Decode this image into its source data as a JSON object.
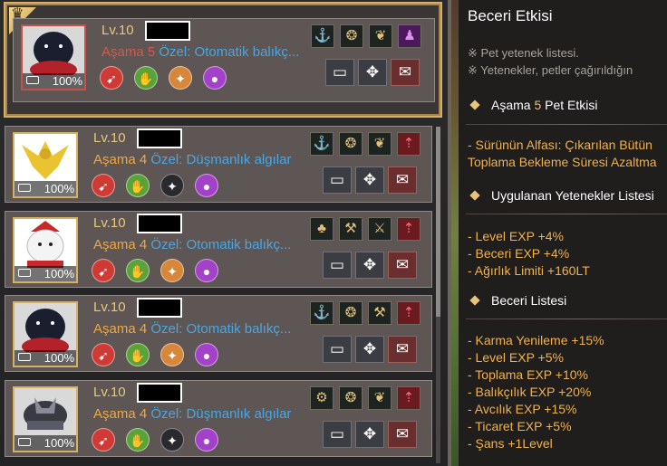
{
  "pets": [
    {
      "level": "Lv.10",
      "stage_label": "Aşama",
      "stage_num": "5",
      "special": "Özel: Otomatik balıkç...",
      "hunger": "100%"
    },
    {
      "level": "Lv.10",
      "stage_label": "Aşama",
      "stage_num": "4",
      "special": "Özel: Düşmanlık algılar",
      "hunger": "100%"
    },
    {
      "level": "Lv.10",
      "stage_label": "Aşama",
      "stage_num": "4",
      "special": "Özel: Otomatik balıkç...",
      "hunger": "100%"
    },
    {
      "level": "Lv.10",
      "stage_label": "Aşama",
      "stage_num": "4",
      "special": "Özel: Otomatik balıkç...",
      "hunger": "100%"
    },
    {
      "level": "Lv.10",
      "stage_label": "Aşama",
      "stage_num": "4",
      "special": "Özel: Düşmanlık algılar",
      "hunger": "100%"
    }
  ],
  "panel": {
    "title": "Beceri Etkisi",
    "note1": "※ Pet yetenek listesi.",
    "note2": "※ Yetenekler, petler çağırıldığın",
    "section_stage_pre": "Aşama",
    "section_stage_num": "5",
    "section_stage_post": "Pet Etkisi",
    "alpha1": "- Sürünün Alfası: Çıkarılan Bütün",
    "alpha2": "Toplama Bekleme Süresi Azaltma",
    "section_applied": "Uygulanan Yetenekler Listesi",
    "applied": [
      {
        "label": "- Level EXP",
        "value": "+4%"
      },
      {
        "label": "- Beceri EXP",
        "value": "+4%"
      },
      {
        "label": "- Ağırlık Limiti",
        "value": "+160LT"
      }
    ],
    "section_list": "Beceri Listesi",
    "skills": [
      {
        "label": "- Karma Yenileme",
        "value": "+15%"
      },
      {
        "label": "- Level EXP",
        "value": "+5%"
      },
      {
        "label": "- Toplama EXP",
        "value": "+10%"
      },
      {
        "label": "- Balıkçılık EXP",
        "value": "+20%"
      },
      {
        "label": "- Avcılık EXP",
        "value": "+15%"
      },
      {
        "label": "- Ticaret EXP",
        "value": "+5%"
      },
      {
        "label": "- Şans",
        "value": "+1Level"
      }
    ]
  },
  "colors": {
    "gold": "#d7b066",
    "orange": "#f0a743",
    "blue": "#4aa6e2",
    "red_stage": "#d35a4c"
  }
}
